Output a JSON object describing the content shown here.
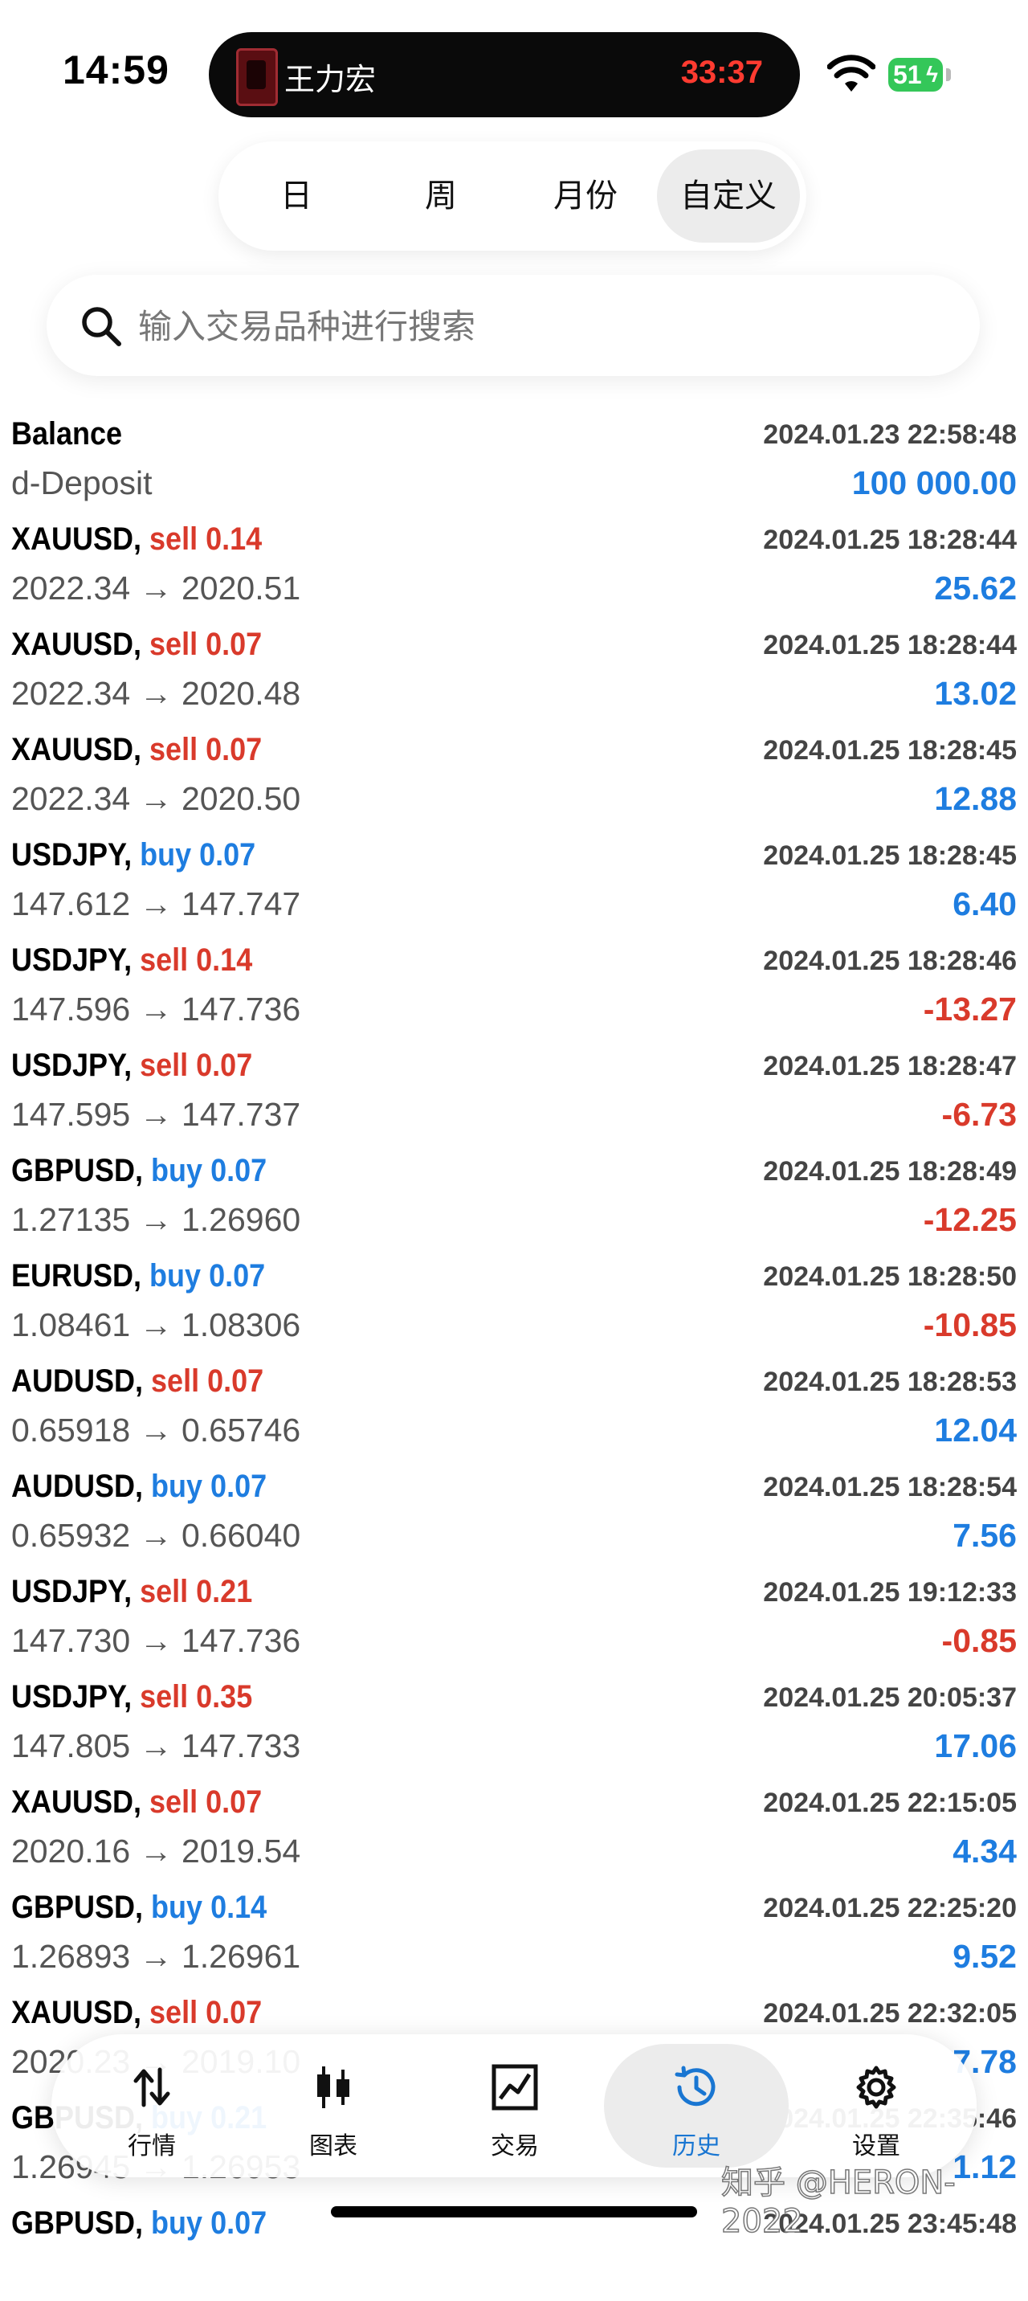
{
  "status_bar": {
    "time": "14:59",
    "live_activity_title": "王力宏",
    "live_activity_timer": "33:37",
    "battery": "51"
  },
  "segment": {
    "items": [
      "日",
      "周",
      "月份",
      "自定义"
    ],
    "selected": "自定义"
  },
  "search": {
    "placeholder": "输入交易品种进行搜索",
    "value": ""
  },
  "colors": {
    "sell": "#d93a2b",
    "buy": "#1e7de0",
    "positive": "#1e7de0",
    "negative": "#d93a2b"
  },
  "records": [
    {
      "symbol": "Balance",
      "side": "",
      "volume": "",
      "time": "2024.01.23 22:58:48",
      "price": "d-Deposit",
      "profit": "100 000.00",
      "profit_sign": "positive"
    },
    {
      "symbol": "XAUUSD,",
      "side": "sell",
      "volume": "0.14",
      "time": "2024.01.25 18:28:44",
      "price": "2022.34 → 2020.51",
      "profit": "25.62",
      "profit_sign": "positive"
    },
    {
      "symbol": "XAUUSD,",
      "side": "sell",
      "volume": "0.07",
      "time": "2024.01.25 18:28:44",
      "price": "2022.34 → 2020.48",
      "profit": "13.02",
      "profit_sign": "positive"
    },
    {
      "symbol": "XAUUSD,",
      "side": "sell",
      "volume": "0.07",
      "time": "2024.01.25 18:28:45",
      "price": "2022.34 → 2020.50",
      "profit": "12.88",
      "profit_sign": "positive"
    },
    {
      "symbol": "USDJPY,",
      "side": "buy",
      "volume": "0.07",
      "time": "2024.01.25 18:28:45",
      "price": "147.612 → 147.747",
      "profit": "6.40",
      "profit_sign": "positive"
    },
    {
      "symbol": "USDJPY,",
      "side": "sell",
      "volume": "0.14",
      "time": "2024.01.25 18:28:46",
      "price": "147.596 → 147.736",
      "profit": "-13.27",
      "profit_sign": "negative"
    },
    {
      "symbol": "USDJPY,",
      "side": "sell",
      "volume": "0.07",
      "time": "2024.01.25 18:28:47",
      "price": "147.595 → 147.737",
      "profit": "-6.73",
      "profit_sign": "negative"
    },
    {
      "symbol": "GBPUSD,",
      "side": "buy",
      "volume": "0.07",
      "time": "2024.01.25 18:28:49",
      "price": "1.27135 → 1.26960",
      "profit": "-12.25",
      "profit_sign": "negative"
    },
    {
      "symbol": "EURUSD,",
      "side": "buy",
      "volume": "0.07",
      "time": "2024.01.25 18:28:50",
      "price": "1.08461 → 1.08306",
      "profit": "-10.85",
      "profit_sign": "negative"
    },
    {
      "symbol": "AUDUSD,",
      "side": "sell",
      "volume": "0.07",
      "time": "2024.01.25 18:28:53",
      "price": "0.65918 → 0.65746",
      "profit": "12.04",
      "profit_sign": "positive"
    },
    {
      "symbol": "AUDUSD,",
      "side": "buy",
      "volume": "0.07",
      "time": "2024.01.25 18:28:54",
      "price": "0.65932 → 0.66040",
      "profit": "7.56",
      "profit_sign": "positive"
    },
    {
      "symbol": "USDJPY,",
      "side": "sell",
      "volume": "0.21",
      "time": "2024.01.25 19:12:33",
      "price": "147.730 → 147.736",
      "profit": "-0.85",
      "profit_sign": "negative"
    },
    {
      "symbol": "USDJPY,",
      "side": "sell",
      "volume": "0.35",
      "time": "2024.01.25 20:05:37",
      "price": "147.805 → 147.733",
      "profit": "17.06",
      "profit_sign": "positive"
    },
    {
      "symbol": "XAUUSD,",
      "side": "sell",
      "volume": "0.07",
      "time": "2024.01.25 22:15:05",
      "price": "2020.16 → 2019.54",
      "profit": "4.34",
      "profit_sign": "positive"
    },
    {
      "symbol": "GBPUSD,",
      "side": "buy",
      "volume": "0.14",
      "time": "2024.01.25 22:25:20",
      "price": "1.26893 → 1.26961",
      "profit": "9.52",
      "profit_sign": "positive"
    },
    {
      "symbol": "XAUUSD,",
      "side": "sell",
      "volume": "0.07",
      "time": "2024.01.25 22:32:05",
      "price": "2020.23 → 2019.10",
      "profit": "7.78",
      "profit_sign": "positive"
    },
    {
      "symbol": "GBPUSD,",
      "side": "buy",
      "volume": "0.21",
      "time": "2024.01.25 22:35:46",
      "price": "1.26945 → 1.26953",
      "profit": "1.12",
      "profit_sign": "positive"
    },
    {
      "symbol": "GBPUSD,",
      "side": "buy",
      "volume": "0.07",
      "time": "2024.01.25 23:45:48",
      "price": "",
      "profit": "",
      "profit_sign": "positive"
    }
  ],
  "tabbar": {
    "items": [
      {
        "label": "行情",
        "icon": "quotes-arrows-icon"
      },
      {
        "label": "图表",
        "icon": "candlestick-chart-icon"
      },
      {
        "label": "交易",
        "icon": "trade-chart-icon"
      },
      {
        "label": "历史",
        "icon": "history-clock-icon"
      },
      {
        "label": "设置",
        "icon": "gear-icon"
      }
    ],
    "selected": "历史"
  },
  "watermark": "知乎 @HERON-2022"
}
